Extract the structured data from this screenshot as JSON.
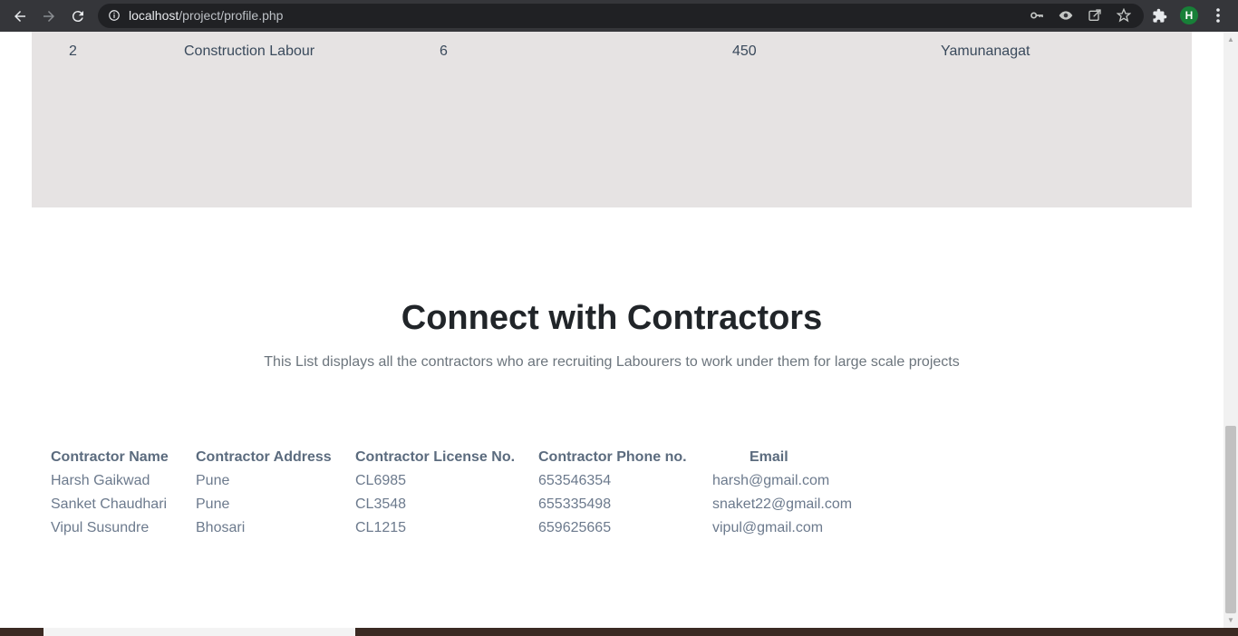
{
  "browser": {
    "url_host": "localhost",
    "url_path": "/project/profile.php",
    "profile_initial": "H"
  },
  "previous_table": {
    "row": {
      "id": "2",
      "category": "Construction Labour",
      "count": "6",
      "wage": "450",
      "location": "Yamunanagat"
    }
  },
  "contractors": {
    "title": "Connect with Contractors",
    "subtitle": "This List displays all the contractors who are recruiting Labourers to work under them for large scale projects",
    "headers": {
      "name": "Contractor Name",
      "address": "Contractor Address",
      "license": "Contractor License No.",
      "phone": "Contractor Phone no.",
      "email": "Email"
    },
    "rows": [
      {
        "name": "Harsh Gaikwad",
        "address": "Pune",
        "license": "CL6985",
        "phone": "653546354",
        "email": "harsh@gmail.com"
      },
      {
        "name": "Sanket Chaudhari",
        "address": "Pune",
        "license": "CL3548",
        "phone": "655335498",
        "email": "snaket22@gmail.com"
      },
      {
        "name": "Vipul Susundre",
        "address": "Bhosari",
        "license": "CL1215",
        "phone": "659625665",
        "email": "vipul@gmail.com"
      }
    ]
  },
  "colors": {
    "chrome": "#35363a",
    "panel": "#e6e3e3",
    "heading": "#212529",
    "muted": "#6c757d"
  }
}
